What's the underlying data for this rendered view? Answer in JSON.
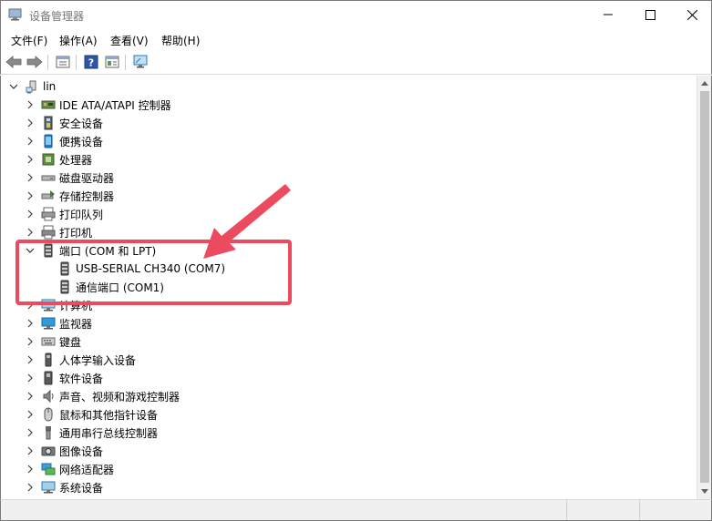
{
  "window": {
    "title": "设备管理器"
  },
  "menu": [
    {
      "label": "文件(F)"
    },
    {
      "label": "操作(A)"
    },
    {
      "label": "查看(V)"
    },
    {
      "label": "帮助(H)"
    }
  ],
  "tree": {
    "root": {
      "label": "lin"
    },
    "categories": [
      {
        "label": "IDE ATA/ATAPI 控制器",
        "icon": "ide-controller-icon"
      },
      {
        "label": "安全设备",
        "icon": "security-device-icon"
      },
      {
        "label": "便携设备",
        "icon": "portable-device-icon"
      },
      {
        "label": "处理器",
        "icon": "processor-icon"
      },
      {
        "label": "磁盘驱动器",
        "icon": "disk-drive-icon"
      },
      {
        "label": "存储控制器",
        "icon": "storage-controller-icon"
      },
      {
        "label": "打印队列",
        "icon": "print-queue-icon"
      },
      {
        "label": "打印机",
        "icon": "printer-icon"
      },
      {
        "label": "端口 (COM 和 LPT)",
        "icon": "port-icon",
        "expanded": true,
        "children": [
          {
            "label": "USB-SERIAL CH340 (COM7)",
            "icon": "port-icon"
          },
          {
            "label": "通信端口 (COM1)",
            "icon": "port-icon"
          }
        ]
      },
      {
        "label": "计算机",
        "icon": "computer-icon"
      },
      {
        "label": "监视器",
        "icon": "monitor-icon"
      },
      {
        "label": "键盘",
        "icon": "keyboard-icon"
      },
      {
        "label": "人体学输入设备",
        "icon": "hid-icon"
      },
      {
        "label": "软件设备",
        "icon": "software-device-icon"
      },
      {
        "label": "声音、视频和游戏控制器",
        "icon": "sound-icon"
      },
      {
        "label": "鼠标和其他指针设备",
        "icon": "mouse-icon"
      },
      {
        "label": "通用串行总线控制器",
        "icon": "usb-icon"
      },
      {
        "label": "图像设备",
        "icon": "imaging-device-icon"
      },
      {
        "label": "网络适配器",
        "icon": "network-adapter-icon"
      },
      {
        "label": "系统设备",
        "icon": "system-device-icon"
      }
    ]
  },
  "colors": {
    "highlight": "#ec4a5e",
    "border": "#7a7a7a"
  }
}
